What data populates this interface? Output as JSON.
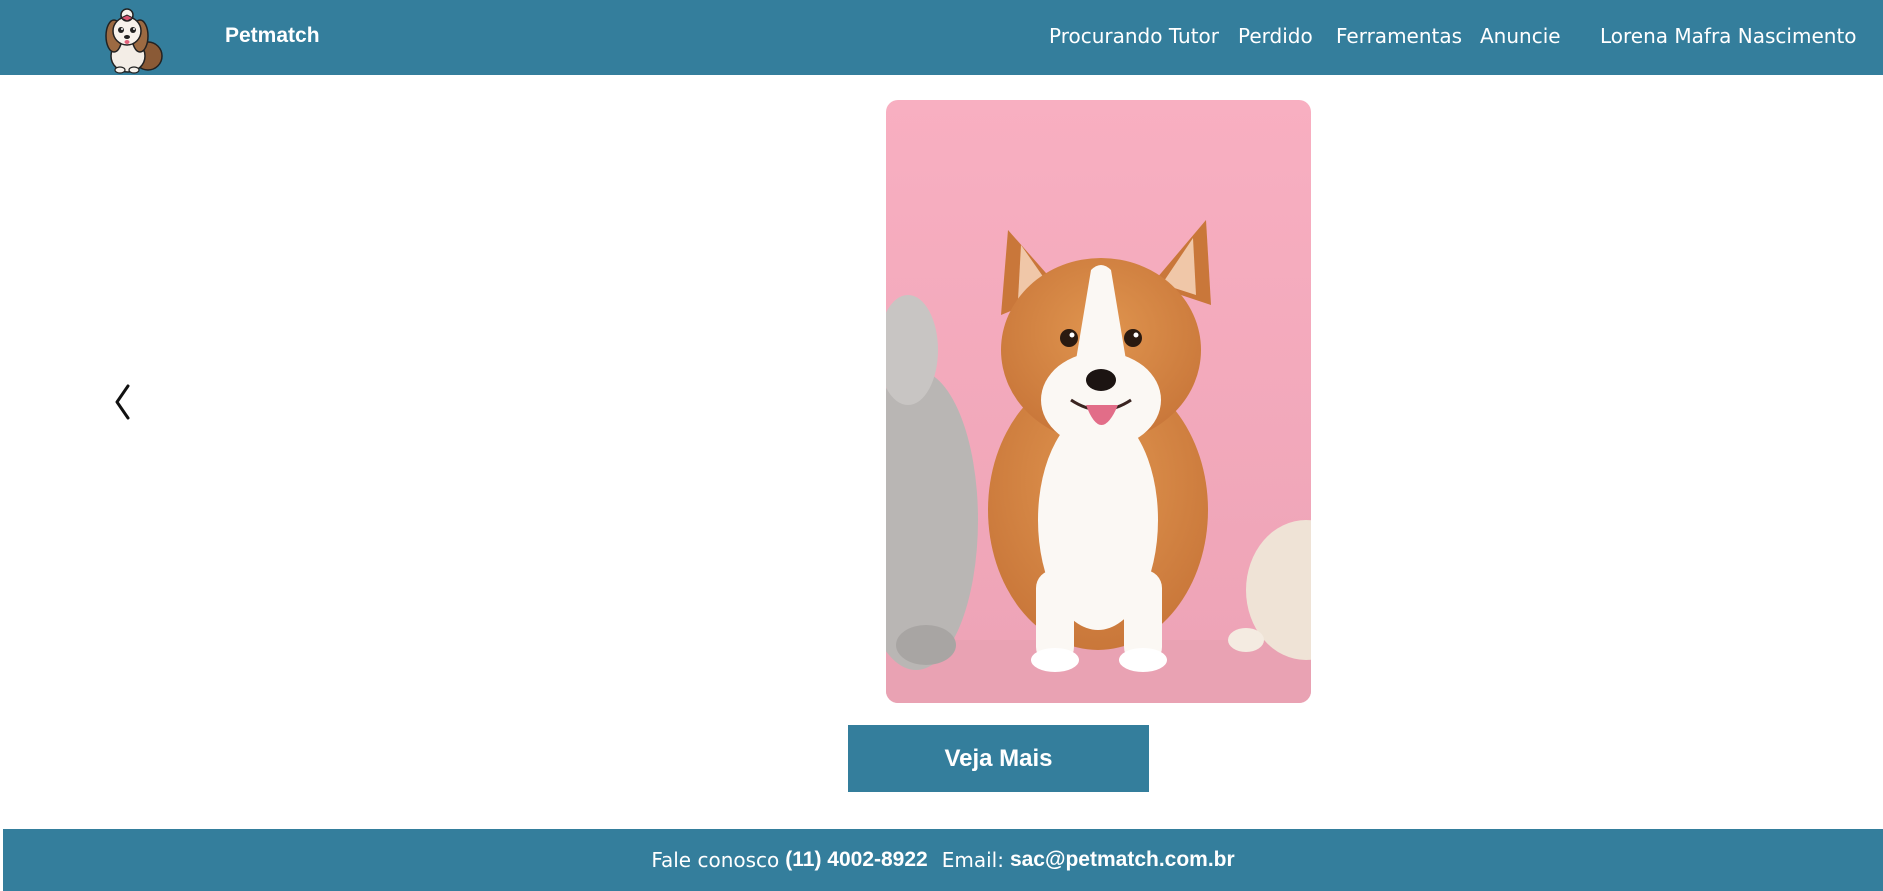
{
  "header": {
    "brand": "Petmatch",
    "logo_icon": "shih-tzu-dog-logo",
    "nav": [
      {
        "label": "Procurando Tutor"
      },
      {
        "label": "Perdido"
      },
      {
        "label": "Ferramentas"
      },
      {
        "label": "Anuncie"
      }
    ],
    "user_name": "Lorena Mafra Nascimento"
  },
  "carousel": {
    "prev_icon": "chevron-left-icon",
    "image_subject": "corgi-dog-photo"
  },
  "cta": {
    "label": "Veja Mais"
  },
  "footer": {
    "contact_label": "Fale conosco",
    "phone": "(11) 4002-8922",
    "email_label": "Email:",
    "email": "sac@petmatch.com.br"
  },
  "colors": {
    "primary": "#347e9c",
    "photo_background": "#f6abbd"
  }
}
